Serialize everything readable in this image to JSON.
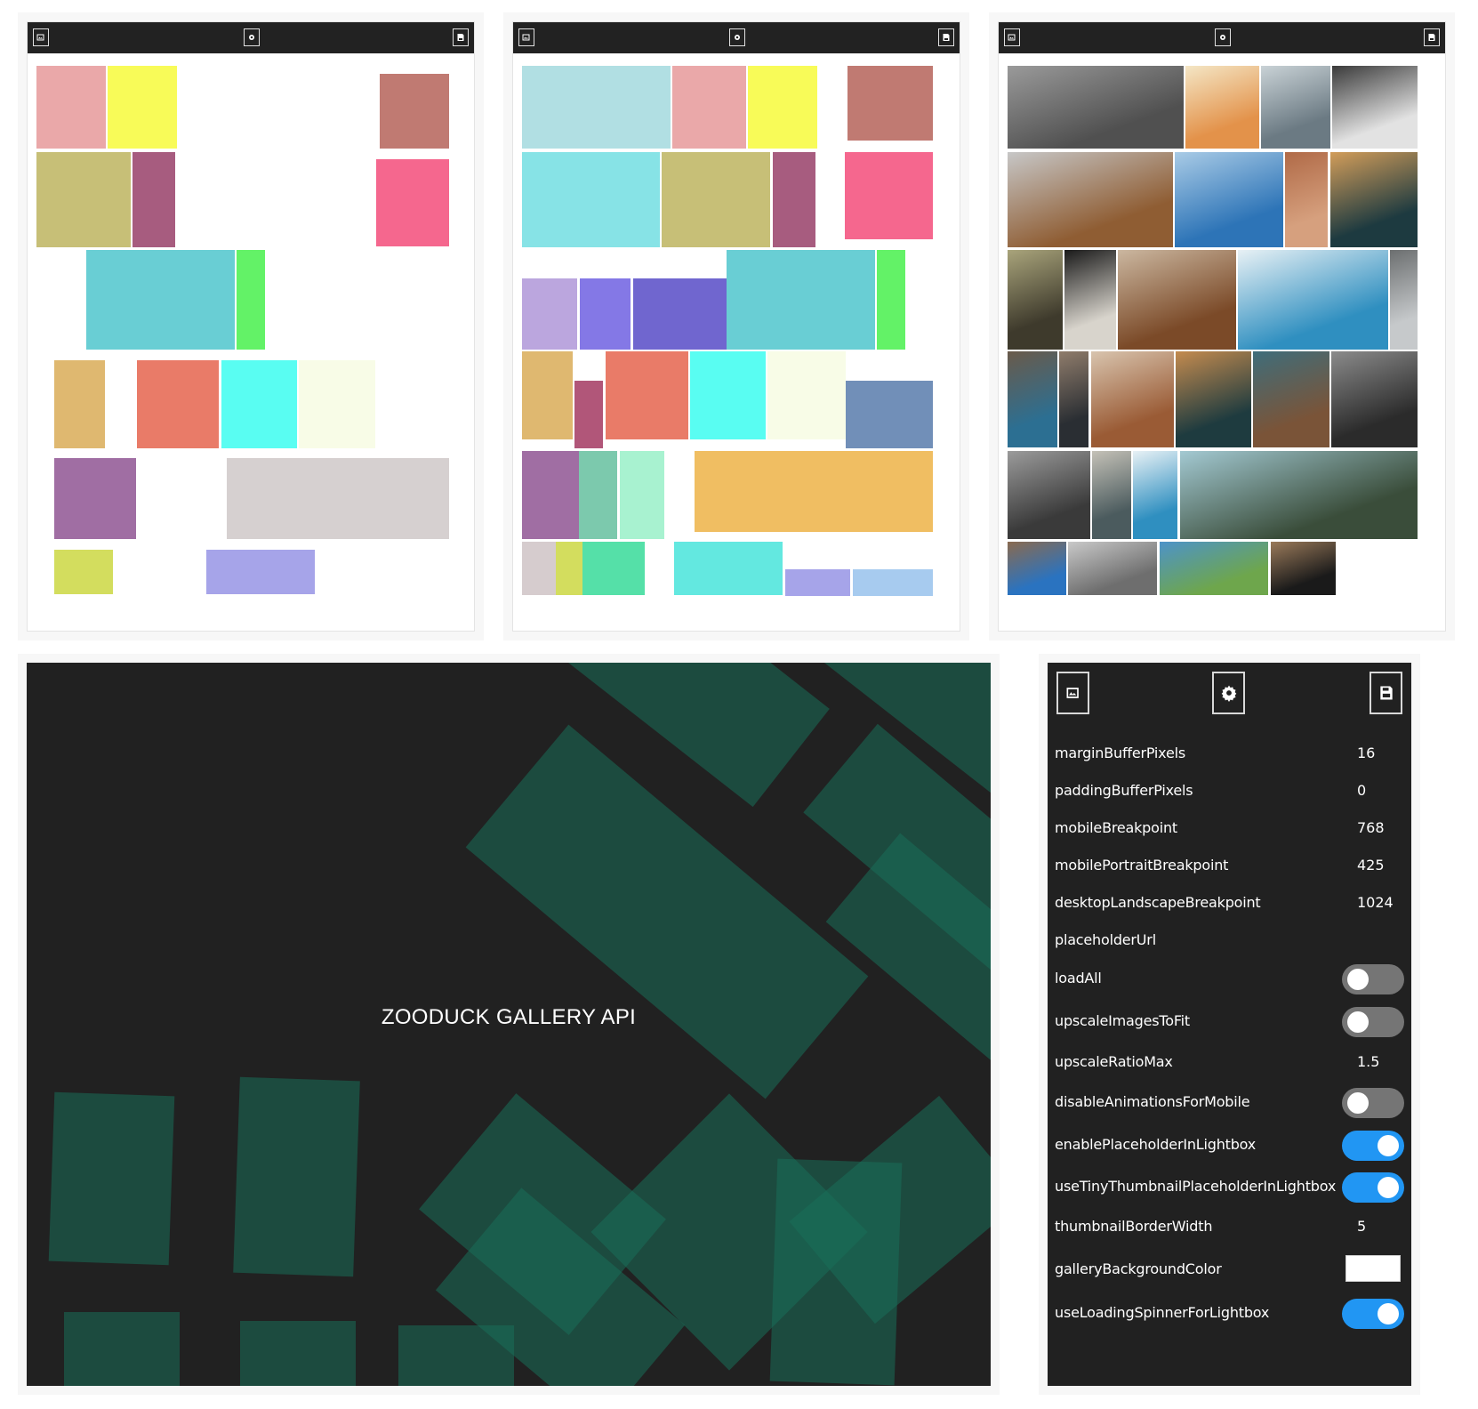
{
  "toolbar": {
    "icons": [
      "gallery-icon",
      "gear-icon",
      "save-icon"
    ]
  },
  "panels": [
    {
      "name": "rectangles-basic",
      "rects": [
        {
          "color": "#eaa8a9"
        },
        {
          "color": "#f8fb58"
        },
        {
          "color": "#c07a72"
        },
        {
          "color": "#c7bf77"
        },
        {
          "color": "#a75c7f"
        },
        {
          "color": "#f5678e"
        },
        {
          "color": "#69ced4"
        },
        {
          "color": "#63f267"
        },
        {
          "color": "#dfb870"
        },
        {
          "color": "#e97b68"
        },
        {
          "color": "#59fdf2"
        },
        {
          "color": "#f8fce7"
        },
        {
          "color": "#a06ea3"
        },
        {
          "color": "#d6d0d0"
        },
        {
          "color": "#d3dd5e"
        },
        {
          "color": "#a6a4e9"
        }
      ]
    },
    {
      "name": "rectangles-overlapping",
      "rects": [
        {
          "color": "#b1dfe3"
        },
        {
          "color": "#eaa8a9"
        },
        {
          "color": "#f8fb58"
        },
        {
          "color": "#c07a72"
        },
        {
          "color": "#87e3e6"
        },
        {
          "color": "#c7bf77"
        },
        {
          "color": "#a75c7f"
        },
        {
          "color": "#f5678e"
        },
        {
          "color": "#bba6de"
        },
        {
          "color": "#8478e6"
        },
        {
          "color": "#7066cf"
        },
        {
          "color": "#3d9ecc"
        },
        {
          "color": "#69ced4"
        },
        {
          "color": "#63f267"
        },
        {
          "color": "#dfb870"
        },
        {
          "color": "#b15679"
        },
        {
          "color": "#e97b68"
        },
        {
          "color": "#59fdf2"
        },
        {
          "color": "#f8fce7"
        },
        {
          "color": "#718fb8"
        },
        {
          "color": "#a06ea3"
        },
        {
          "color": "#7cc9ad"
        },
        {
          "color": "#a8f2d0"
        },
        {
          "color": "#f0be62"
        },
        {
          "color": "#d6ccce"
        },
        {
          "color": "#d3dd5e"
        },
        {
          "color": "#55e0a8"
        },
        {
          "color": "#63e8e0"
        },
        {
          "color": "#a6a4e9"
        },
        {
          "color": "#a7cbef"
        },
        {
          "color": "#79d07a"
        }
      ]
    },
    {
      "name": "photo-gallery",
      "images": [
        {
          "subject": "grass",
          "colors": [
            "#505050",
            "#9a9a9a"
          ]
        },
        {
          "subject": "orange-plant",
          "colors": [
            "#e3924a",
            "#f4e6c5"
          ]
        },
        {
          "subject": "rocky-shore",
          "colors": [
            "#6b7a83",
            "#c9d2d6"
          ]
        },
        {
          "subject": "record-player",
          "colors": [
            "#e2e2e2",
            "#3a3a3a"
          ]
        },
        {
          "subject": "laptop-on-wood",
          "colors": [
            "#8f5d33",
            "#c7c7c7"
          ]
        },
        {
          "subject": "sea-city-skyline",
          "colors": [
            "#2d74b7",
            "#a9cbe6"
          ]
        },
        {
          "subject": "beach-sunset",
          "colors": [
            "#d6a07e",
            "#b06a47"
          ]
        },
        {
          "subject": "dark-forest",
          "colors": [
            "#1d3a40",
            "#d29d5a"
          ]
        },
        {
          "subject": "grapes",
          "colors": [
            "#3e3a2c",
            "#a9a47b"
          ]
        },
        {
          "subject": "laptop-desk",
          "colors": [
            "#d8d4cc",
            "#1a1a1a"
          ]
        },
        {
          "subject": "coffee-table",
          "colors": [
            "#7b4a28",
            "#cbb7a0"
          ]
        },
        {
          "subject": "sky-clouds",
          "colors": [
            "#2f8fc0",
            "#e8f1f5"
          ]
        },
        {
          "subject": "pier",
          "colors": [
            "#c6c9cb",
            "#6c6f70"
          ]
        },
        {
          "subject": "sea-rocks",
          "colors": [
            "#2c6f92",
            "#6a5a4a"
          ]
        },
        {
          "subject": "phone-desk",
          "colors": [
            "#2a2e33",
            "#8f7c6b"
          ]
        },
        {
          "subject": "wood-table",
          "colors": [
            "#9a5b35",
            "#d8c4ae"
          ]
        },
        {
          "subject": "forest-lake",
          "colors": [
            "#1e3b3f",
            "#c48b4f"
          ]
        },
        {
          "subject": "barn",
          "colors": [
            "#7a5438",
            "#3f6d7a"
          ]
        },
        {
          "subject": "bridge-night",
          "colors": [
            "#2b2b2b",
            "#8b8b8b"
          ]
        },
        {
          "subject": "bridge-tower",
          "colors": [
            "#3a3a3a",
            "#9b9b9b"
          ]
        },
        {
          "subject": "cloud",
          "colors": [
            "#4b5b5e",
            "#c4c1b7"
          ]
        },
        {
          "subject": "sky-clouds-wide",
          "colors": [
            "#2f8fc0",
            "#e8f1f5"
          ]
        },
        {
          "subject": "waterfall",
          "colors": [
            "#3a4d3a",
            "#a3c9d2"
          ]
        },
        {
          "subject": "dock",
          "colors": [
            "#2a73c0",
            "#8a6a4f"
          ]
        },
        {
          "subject": "town",
          "colors": [
            "#6e6e6e",
            "#c9c9c9"
          ]
        },
        {
          "subject": "grass-sky",
          "colors": [
            "#6ea64c",
            "#4d93c9"
          ]
        },
        {
          "subject": "laptop-dark",
          "colors": [
            "#1a1a1a",
            "#9a7a5a"
          ]
        }
      ]
    }
  ],
  "demo": {
    "title": "ZOODUCK GALLERY API",
    "background": "#212121",
    "shape_color": "#1a705a"
  },
  "settings": {
    "buttons": [
      {
        "name": "gallery-button",
        "icon": "gallery-icon"
      },
      {
        "name": "settings-button",
        "icon": "gear-icon"
      },
      {
        "name": "save-button",
        "icon": "save-icon"
      }
    ],
    "rows": [
      {
        "label": "marginBufferPixels",
        "type": "value",
        "value": "16"
      },
      {
        "label": "paddingBufferPixels",
        "type": "value",
        "value": "0"
      },
      {
        "label": "mobileBreakpoint",
        "type": "value",
        "value": "768"
      },
      {
        "label": "mobilePortraitBreakpoint",
        "type": "value",
        "value": "425"
      },
      {
        "label": "desktopLandscapeBreakpoint",
        "type": "value",
        "value": "1024"
      },
      {
        "label": "placeholderUrl",
        "type": "value",
        "value": ""
      },
      {
        "label": "loadAll",
        "type": "toggle",
        "on": false
      },
      {
        "label": "upscaleImagesToFit",
        "type": "toggle",
        "on": false
      },
      {
        "label": "upscaleRatioMax",
        "type": "value",
        "value": "1.5"
      },
      {
        "label": "disableAnimationsForMobile",
        "type": "toggle",
        "on": false
      },
      {
        "label": "enablePlaceholderInLightbox",
        "type": "toggle",
        "on": true
      },
      {
        "label": "useTinyThumbnailPlaceholderInLightbox",
        "type": "toggle",
        "on": true
      },
      {
        "label": "thumbnailBorderWidth",
        "type": "value",
        "value": "5"
      },
      {
        "label": "galleryBackgroundColor",
        "type": "color",
        "value": "#ffffff"
      },
      {
        "label": "useLoadingSpinnerForLightbox",
        "type": "toggle",
        "on": true
      }
    ]
  }
}
